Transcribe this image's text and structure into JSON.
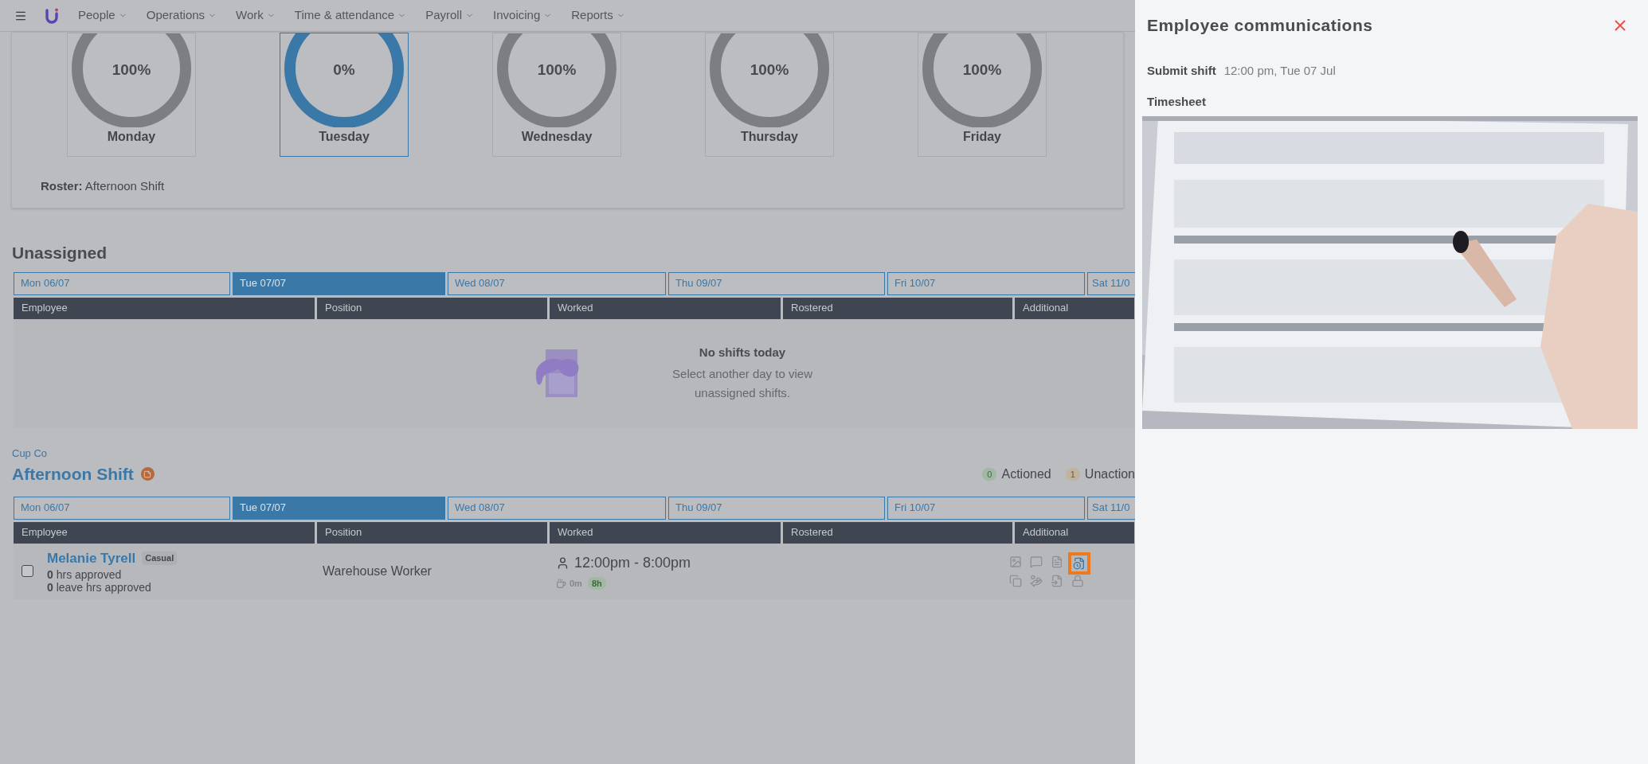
{
  "nav": {
    "items": [
      {
        "label": "People"
      },
      {
        "label": "Operations"
      },
      {
        "label": "Work"
      },
      {
        "label": "Time & attendance"
      },
      {
        "label": "Payroll"
      },
      {
        "label": "Invoicing"
      },
      {
        "label": "Reports"
      }
    ]
  },
  "week_summary": {
    "days": [
      {
        "percent": "100%",
        "day": "Monday",
        "selected": false
      },
      {
        "percent": "0%",
        "day": "Tuesday",
        "selected": true
      },
      {
        "percent": "100%",
        "day": "Wednesday",
        "selected": false
      },
      {
        "percent": "100%",
        "day": "Thursday",
        "selected": false
      },
      {
        "percent": "100%",
        "day": "Friday",
        "selected": false
      }
    ],
    "roster_label": "Roster:",
    "roster_value": "Afternoon Shift"
  },
  "unassigned": {
    "title": "Unassigned",
    "day_tabs": [
      {
        "label": "Mon 06/07",
        "selected": false
      },
      {
        "label": "Tue 07/07",
        "selected": true
      },
      {
        "label": "Wed 08/07",
        "selected": false
      },
      {
        "label": "Thu 09/07",
        "selected": false
      },
      {
        "label": "Fri 10/07",
        "selected": false
      },
      {
        "label": "Sat 11/0",
        "selected": false
      }
    ],
    "columns": [
      "Employee",
      "Position",
      "Worked",
      "Rostered",
      "Additional"
    ],
    "empty_title": "No shifts today",
    "empty_text": "Select another day to view unassigned shifts."
  },
  "shift": {
    "company": "Cup Co",
    "title": "Afternoon Shift",
    "actioned_count": "0",
    "actioned_label": "Actioned",
    "unactioned_count": "1",
    "unactioned_label": "Unaction",
    "day_tabs": [
      {
        "label": "Mon 06/07",
        "selected": false
      },
      {
        "label": "Tue 07/07",
        "selected": true
      },
      {
        "label": "Wed 08/07",
        "selected": false
      },
      {
        "label": "Thu 09/07",
        "selected": false
      },
      {
        "label": "Fri 10/07",
        "selected": false
      },
      {
        "label": "Sat 11/0",
        "selected": false
      }
    ],
    "columns": [
      "Employee",
      "Position",
      "Worked",
      "Rostered",
      "Additional"
    ],
    "rows": [
      {
        "checked": false,
        "name": "Melanie Tyrell",
        "employment": "Casual",
        "approved": "**0** hrs approved",
        "leave": "**0** leave hrs approved",
        "position": "Warehouse Worker",
        "time": "12:00pm - 8:00pm",
        "break": "0m",
        "hours": "8h"
      }
    ]
  },
  "panel": {
    "title": "Employee communications",
    "event_label": "Submit shift",
    "event_time": "12:00 pm, Tue 07 Jul",
    "attachment_label": "Timesheet"
  }
}
